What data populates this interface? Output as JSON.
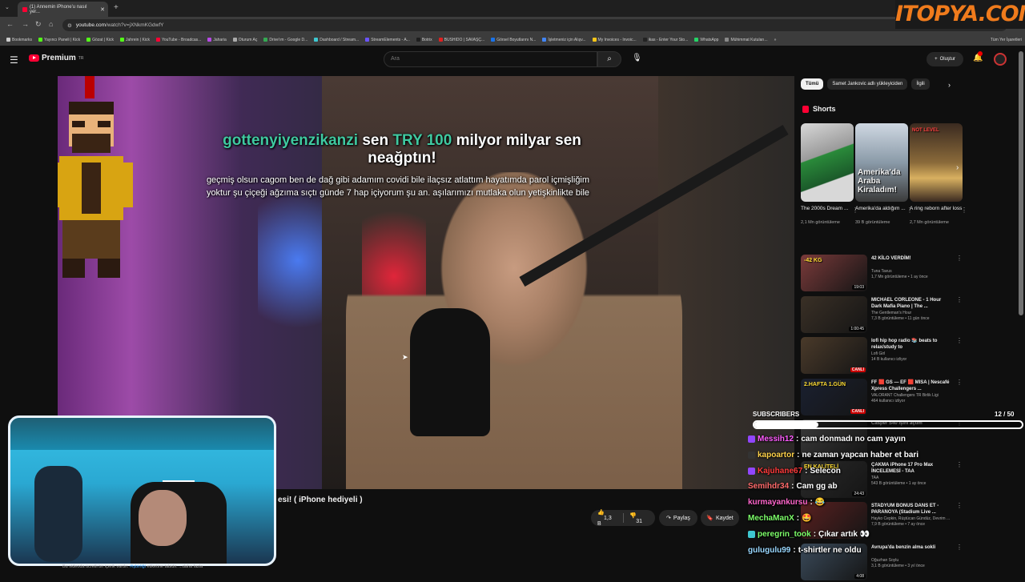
{
  "browser": {
    "tab_title": "(1) Annemin iPhone'u nasıl yer...",
    "url_host": "youtube.com",
    "url_path": "/watch?v=jXNkmKGdwfY",
    "bookmarks": [
      {
        "label": "Bookmarks",
        "color": "#cccccc"
      },
      {
        "label": "Yayıncı Paneli | Kick",
        "color": "#53fc18"
      },
      {
        "label": "Gözat | Kick",
        "color": "#53fc18"
      },
      {
        "label": "Jahrein | Kick",
        "color": "#53fc18"
      },
      {
        "label": "YouTube - Broadcas...",
        "color": "#ff0033"
      },
      {
        "label": "Jaharia",
        "color": "#b74ae6"
      },
      {
        "label": "Oturum Aç",
        "color": "#aaaaaa"
      },
      {
        "label": "Drive'ım - Google D...",
        "color": "#34a853"
      },
      {
        "label": "Dashboard / Stream...",
        "color": "#3ec7d0"
      },
      {
        "label": "StreamElements - A...",
        "color": "#6b54ff"
      },
      {
        "label": "Botrix",
        "color": "#1e1e1e"
      },
      {
        "label": "BUSHIDO | SAVAŞÇ...",
        "color": "#e02020"
      },
      {
        "label": "Görsel Boyutlarını N...",
        "color": "#1a73e8"
      },
      {
        "label": "İşletmeniz için Alışv...",
        "color": "#4285f4"
      },
      {
        "label": "My Invoices - Invoic...",
        "color": "#f5c518"
      },
      {
        "label": "ikas - Enter Your Sto...",
        "color": "#222222"
      },
      {
        "label": "WhatsApp",
        "color": "#25d366"
      },
      {
        "label": "Mühimmat Kutuları...",
        "color": "#888888"
      }
    ],
    "all_bookmarks": "Tüm Yer İşaretleri"
  },
  "watermark": "ITOPYA.COM",
  "header": {
    "logo_text": "Premium",
    "logo_sup": "TR",
    "search_placeholder": "Ara",
    "create_label": "Oluştur"
  },
  "alert": {
    "user": "gottenyiyenzikanzi",
    "text1": "sen",
    "amount": "TRY 100",
    "text2": "milyor milyar sen neağptın!",
    "message": "geçmiş olsun cagom ben de dağ gibi adamım covidi bile ilaçsız atlattım hayatımda parol içmişliğim yoktur şu çiçeği ağzıma sıçtı günde 7 hap içiyorum şu an. aşılarımızı mutlaka olun yetişkinlikte bile"
  },
  "video": {
    "title_fragment": "esi! ( iPhone hediyeli )",
    "likes": "1,3 B",
    "dislikes": "31",
    "share_label": "Paylaş",
    "save_label": "Kaydet",
    "desc_text": "Bu videoda ücretli bir içerik vardır.",
    "desc_tag": "#işbirliği",
    "desc_rest": "etiketine tabidir.",
    "desc_more": "...daha fazla"
  },
  "sidebar": {
    "chips": [
      "Tümü",
      "Samet Jankovic adlı yükleyiciden",
      "İlgili"
    ],
    "shorts_heading": "Shorts",
    "shorts": [
      {
        "title": "The 2000s Dream ...",
        "views": "2,1 Mn görüntüleme",
        "thumb_text": ""
      },
      {
        "title": "Amerika'da aldığım ...",
        "views": "39 B görüntüleme",
        "thumb_text": "Amerika'da Araba Kiraladım!"
      },
      {
        "title": "A ring reborn after loss",
        "views": "2,7 Mn görüntüleme",
        "thumb_text": "NOT LEVEL"
      }
    ],
    "recs": [
      {
        "title": "42 KİLO VERDİM!",
        "channel": "Tuna Tavus",
        "meta": "1,7 Mn görüntüleme • 1 ay önce",
        "badge": "19:03",
        "live": false,
        "thumb_text": "-42 KG"
      },
      {
        "title": "MICHAEL CORLEONE - 1 Hour Dark Mafia Piano | The ...",
        "channel": "The Gentleman's Hour",
        "meta": "7,3 B görüntüleme • 11 gün önce",
        "badge": "1:00:45",
        "live": false,
        "thumb_text": ""
      },
      {
        "title": "lofi hip hop radio 📚 beats to relax/study to",
        "channel": "Lofi Girl",
        "meta": "14 B kullanıcı izliyor",
        "badge": "CANLI",
        "live": true,
        "thumb_text": ""
      },
      {
        "title": "FF 🟥 GS — EF 🟥 MISA | Nescafé Xpress Challengers ...",
        "channel": "VALORANT Challengers TR Birlik Ligi",
        "meta": "464 kullanıcı izliyor",
        "badge": "CANLI",
        "live": true,
        "thumb_text": "2.HAFTA 1.GÜN"
      },
      {
        "title": "Casper S40 işini açtım",
        "channel": "",
        "meta": "",
        "badge": "",
        "live": false,
        "thumb_text": ""
      },
      {
        "title": "ÇAKMA iPhone 17 Pro Max İNCELEMESİ - TAA",
        "channel": "TAA",
        "meta": "543 B görüntüleme • 1 ay önce",
        "badge": "24:43",
        "live": false,
        "thumb_text": "EN KALİTELİ"
      },
      {
        "title": "STADYUM BONUS DANS ET - PARANOYA (Stadium Live ...",
        "channel": "Hayko Cepkin, Rüştücan Gündüz, Devrim ...",
        "meta": "7,9 B görüntüleme • 7 ay önce",
        "badge": "",
        "live": false,
        "thumb_text": ""
      },
      {
        "title": "Avrupa'da benzin alma sokli",
        "channel": "Oğuzhan Soylu",
        "meta": "3,1 B görüntüleme • 3 yıl önce",
        "badge": "4:08",
        "live": false,
        "thumb_text": ""
      }
    ]
  },
  "overlay": {
    "subs_label": "SUBSCRIBERS",
    "subs_count": "12 / 50",
    "subs_fraction": 0.24,
    "chat": [
      {
        "user": "Messih12",
        "msg": "cam donmadı no cam yayın",
        "color": "#ff5cff",
        "badge": "#9146ff"
      },
      {
        "user": "kapoartor",
        "msg": "ne zaman yapcan haber et bari",
        "color": "#ffd24a",
        "badge": "#333333"
      },
      {
        "user": "Kajuhane67",
        "msg": "Selecon",
        "color": "#ff3b3b",
        "badge": "#9146ff"
      },
      {
        "user": "Semihdr34",
        "msg": "Cam gg ab",
        "color": "#ff6a6a",
        "badge": ""
      },
      {
        "user": "kurmayankursu",
        "msg": "😂",
        "color": "#ff66cc",
        "badge": ""
      },
      {
        "user": "MechaManX",
        "msg": "🤩",
        "color": "#7dff6a",
        "badge": ""
      },
      {
        "user": "peregrin_took",
        "msg": "Çıkar artık 👀",
        "color": "#7dff6a",
        "badge": "#3ec7d0"
      },
      {
        "user": "gulugulu99",
        "msg": "t-shirtler ne oldu",
        "color": "#9ad8ff",
        "badge": ""
      }
    ]
  }
}
